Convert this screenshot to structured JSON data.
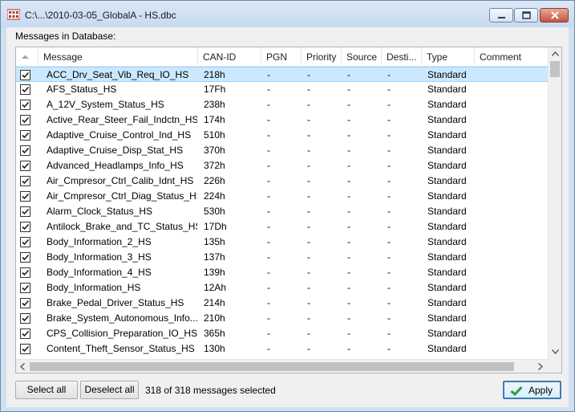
{
  "window": {
    "title": "C:\\...\\2010-03-05_GlobalA - HS.dbc"
  },
  "messages_label": "Messages in Database:",
  "columns": [
    "Message",
    "CAN-ID",
    "PGN",
    "Priority",
    "Source",
    "Desti...",
    "Type",
    "Comment"
  ],
  "rows": [
    {
      "message": "ACC_Drv_Seat_Vib_Req_IO_HS",
      "can_id": "218h",
      "pgn": "-",
      "priority": "-",
      "source": "-",
      "dest": "-",
      "type": "Standard",
      "comment": "",
      "checked": true,
      "selected": true
    },
    {
      "message": "AFS_Status_HS",
      "can_id": "17Fh",
      "pgn": "-",
      "priority": "-",
      "source": "-",
      "dest": "-",
      "type": "Standard",
      "comment": "",
      "checked": true
    },
    {
      "message": "A_12V_System_Status_HS",
      "can_id": "238h",
      "pgn": "-",
      "priority": "-",
      "source": "-",
      "dest": "-",
      "type": "Standard",
      "comment": "",
      "checked": true
    },
    {
      "message": "Active_Rear_Steer_Fail_Indctn_HS",
      "can_id": "174h",
      "pgn": "-",
      "priority": "-",
      "source": "-",
      "dest": "-",
      "type": "Standard",
      "comment": "",
      "checked": true
    },
    {
      "message": "Adaptive_Cruise_Control_Ind_HS",
      "can_id": "510h",
      "pgn": "-",
      "priority": "-",
      "source": "-",
      "dest": "-",
      "type": "Standard",
      "comment": "",
      "checked": true
    },
    {
      "message": "Adaptive_Cruise_Disp_Stat_HS",
      "can_id": "370h",
      "pgn": "-",
      "priority": "-",
      "source": "-",
      "dest": "-",
      "type": "Standard",
      "comment": "",
      "checked": true
    },
    {
      "message": "Advanced_Headlamps_Info_HS",
      "can_id": "372h",
      "pgn": "-",
      "priority": "-",
      "source": "-",
      "dest": "-",
      "type": "Standard",
      "comment": "",
      "checked": true
    },
    {
      "message": "Air_Cmpresor_Ctrl_Calib_Idnt_HS",
      "can_id": "226h",
      "pgn": "-",
      "priority": "-",
      "source": "-",
      "dest": "-",
      "type": "Standard",
      "comment": "",
      "checked": true
    },
    {
      "message": "Air_Cmpresor_Ctrl_Diag_Status_HS",
      "can_id": "224h",
      "pgn": "-",
      "priority": "-",
      "source": "-",
      "dest": "-",
      "type": "Standard",
      "comment": "",
      "checked": true
    },
    {
      "message": "Alarm_Clock_Status_HS",
      "can_id": "530h",
      "pgn": "-",
      "priority": "-",
      "source": "-",
      "dest": "-",
      "type": "Standard",
      "comment": "",
      "checked": true
    },
    {
      "message": "Antilock_Brake_and_TC_Status_HS",
      "can_id": "17Dh",
      "pgn": "-",
      "priority": "-",
      "source": "-",
      "dest": "-",
      "type": "Standard",
      "comment": "",
      "checked": true
    },
    {
      "message": "Body_Information_2_HS",
      "can_id": "135h",
      "pgn": "-",
      "priority": "-",
      "source": "-",
      "dest": "-",
      "type": "Standard",
      "comment": "",
      "checked": true
    },
    {
      "message": "Body_Information_3_HS",
      "can_id": "137h",
      "pgn": "-",
      "priority": "-",
      "source": "-",
      "dest": "-",
      "type": "Standard",
      "comment": "",
      "checked": true
    },
    {
      "message": "Body_Information_4_HS",
      "can_id": "139h",
      "pgn": "-",
      "priority": "-",
      "source": "-",
      "dest": "-",
      "type": "Standard",
      "comment": "",
      "checked": true
    },
    {
      "message": "Body_Information_HS",
      "can_id": "12Ah",
      "pgn": "-",
      "priority": "-",
      "source": "-",
      "dest": "-",
      "type": "Standard",
      "comment": "",
      "checked": true
    },
    {
      "message": "Brake_Pedal_Driver_Status_HS",
      "can_id": "214h",
      "pgn": "-",
      "priority": "-",
      "source": "-",
      "dest": "-",
      "type": "Standard",
      "comment": "",
      "checked": true
    },
    {
      "message": "Brake_System_Autonomous_Info...",
      "can_id": "210h",
      "pgn": "-",
      "priority": "-",
      "source": "-",
      "dest": "-",
      "type": "Standard",
      "comment": "",
      "checked": true
    },
    {
      "message": "CPS_Collision_Preparation_IO_HS",
      "can_id": "365h",
      "pgn": "-",
      "priority": "-",
      "source": "-",
      "dest": "-",
      "type": "Standard",
      "comment": "",
      "checked": true
    },
    {
      "message": "Content_Theft_Sensor_Status_HS",
      "can_id": "130h",
      "pgn": "-",
      "priority": "-",
      "source": "-",
      "dest": "-",
      "type": "Standard",
      "comment": "",
      "checked": true
    }
  ],
  "buttons": {
    "select_all": "Select all",
    "deselect_all": "Deselect all",
    "apply": "Apply"
  },
  "status": "318 of 318 messages selected",
  "colors": {
    "selected_row": "#cce8ff",
    "apply_border": "#3c7fb1",
    "check_green": "#2e9c3a"
  },
  "icons": {
    "app": "dbc-app-icon",
    "sort": "sort-up-icon",
    "apply": "checkmark-icon"
  }
}
